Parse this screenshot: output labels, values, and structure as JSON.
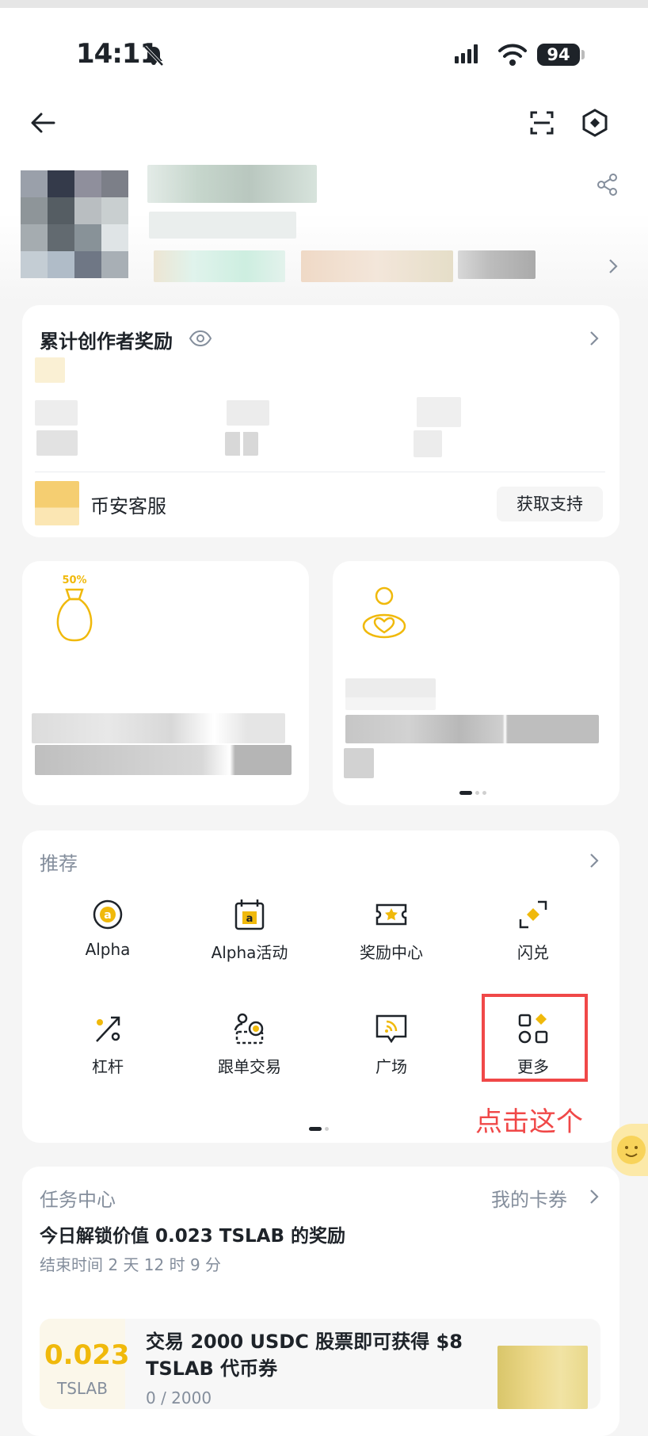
{
  "status_bar": {
    "time": "14:11",
    "battery": "94"
  },
  "creator_card": {
    "title": "累计创作者奖励",
    "service_label": "币安客服",
    "support_button": "获取支持"
  },
  "promo_cards": [
    {
      "badge": "50%"
    }
  ],
  "recommend": {
    "title": "推荐",
    "items": [
      "Alpha",
      "Alpha活动",
      "奖励中心",
      "闪兑",
      "杠杆",
      "跟单交易",
      "广场",
      "更多"
    ]
  },
  "annotation": "点击这个",
  "task_center": {
    "title": "任务中心",
    "my_coupons": "我的卡券",
    "headline": "今日解锁价值 0.023 TSLAB 的奖励",
    "end_time": "结束时间 2 天 12 时 9 分",
    "coupon": {
      "value": "0.023",
      "unit": "TSLAB",
      "title": "交易 2000 USDC 股票即可获得 $8 TSLAB 代币券",
      "progress": "0 / 2000"
    }
  },
  "colors": {
    "accent": "#f0b90b",
    "annotation": "#f04848"
  }
}
